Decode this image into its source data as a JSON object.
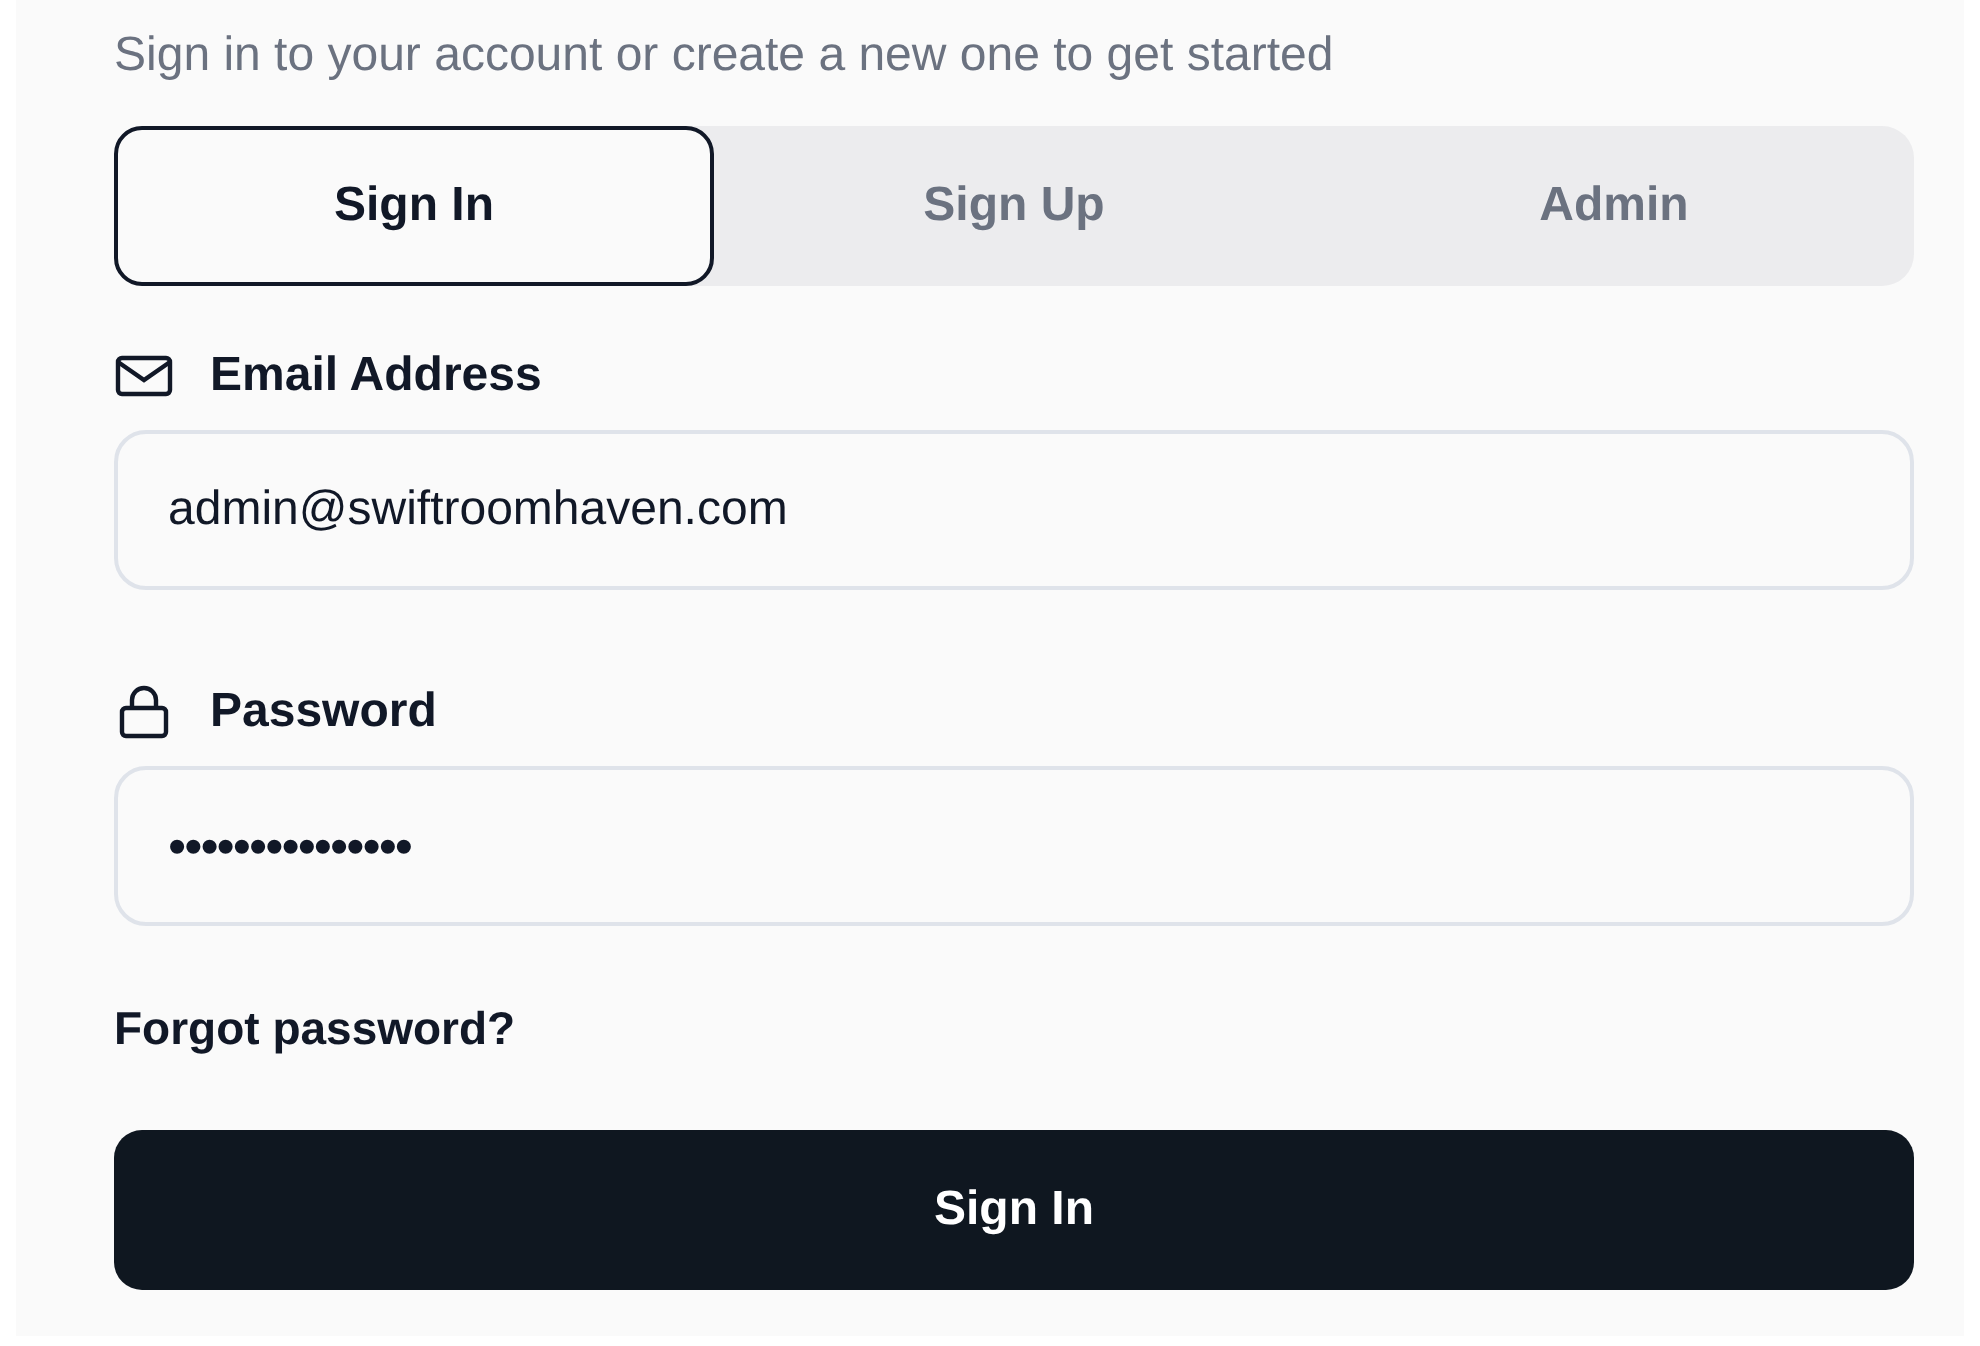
{
  "subtitle": "Sign in to your account or create a new one to get started",
  "tabs": [
    {
      "label": "Sign In",
      "selected": true
    },
    {
      "label": "Sign Up",
      "selected": false
    },
    {
      "label": "Admin",
      "selected": false
    }
  ],
  "fields": [
    {
      "kind": "email",
      "label": "Email Address",
      "value": "admin@swiftroomhaven.com"
    },
    {
      "kind": "password",
      "label": "Password",
      "value": "•••••••••••••••"
    }
  ],
  "forgot_link": "Forgot password?",
  "submit_button": "Sign In"
}
